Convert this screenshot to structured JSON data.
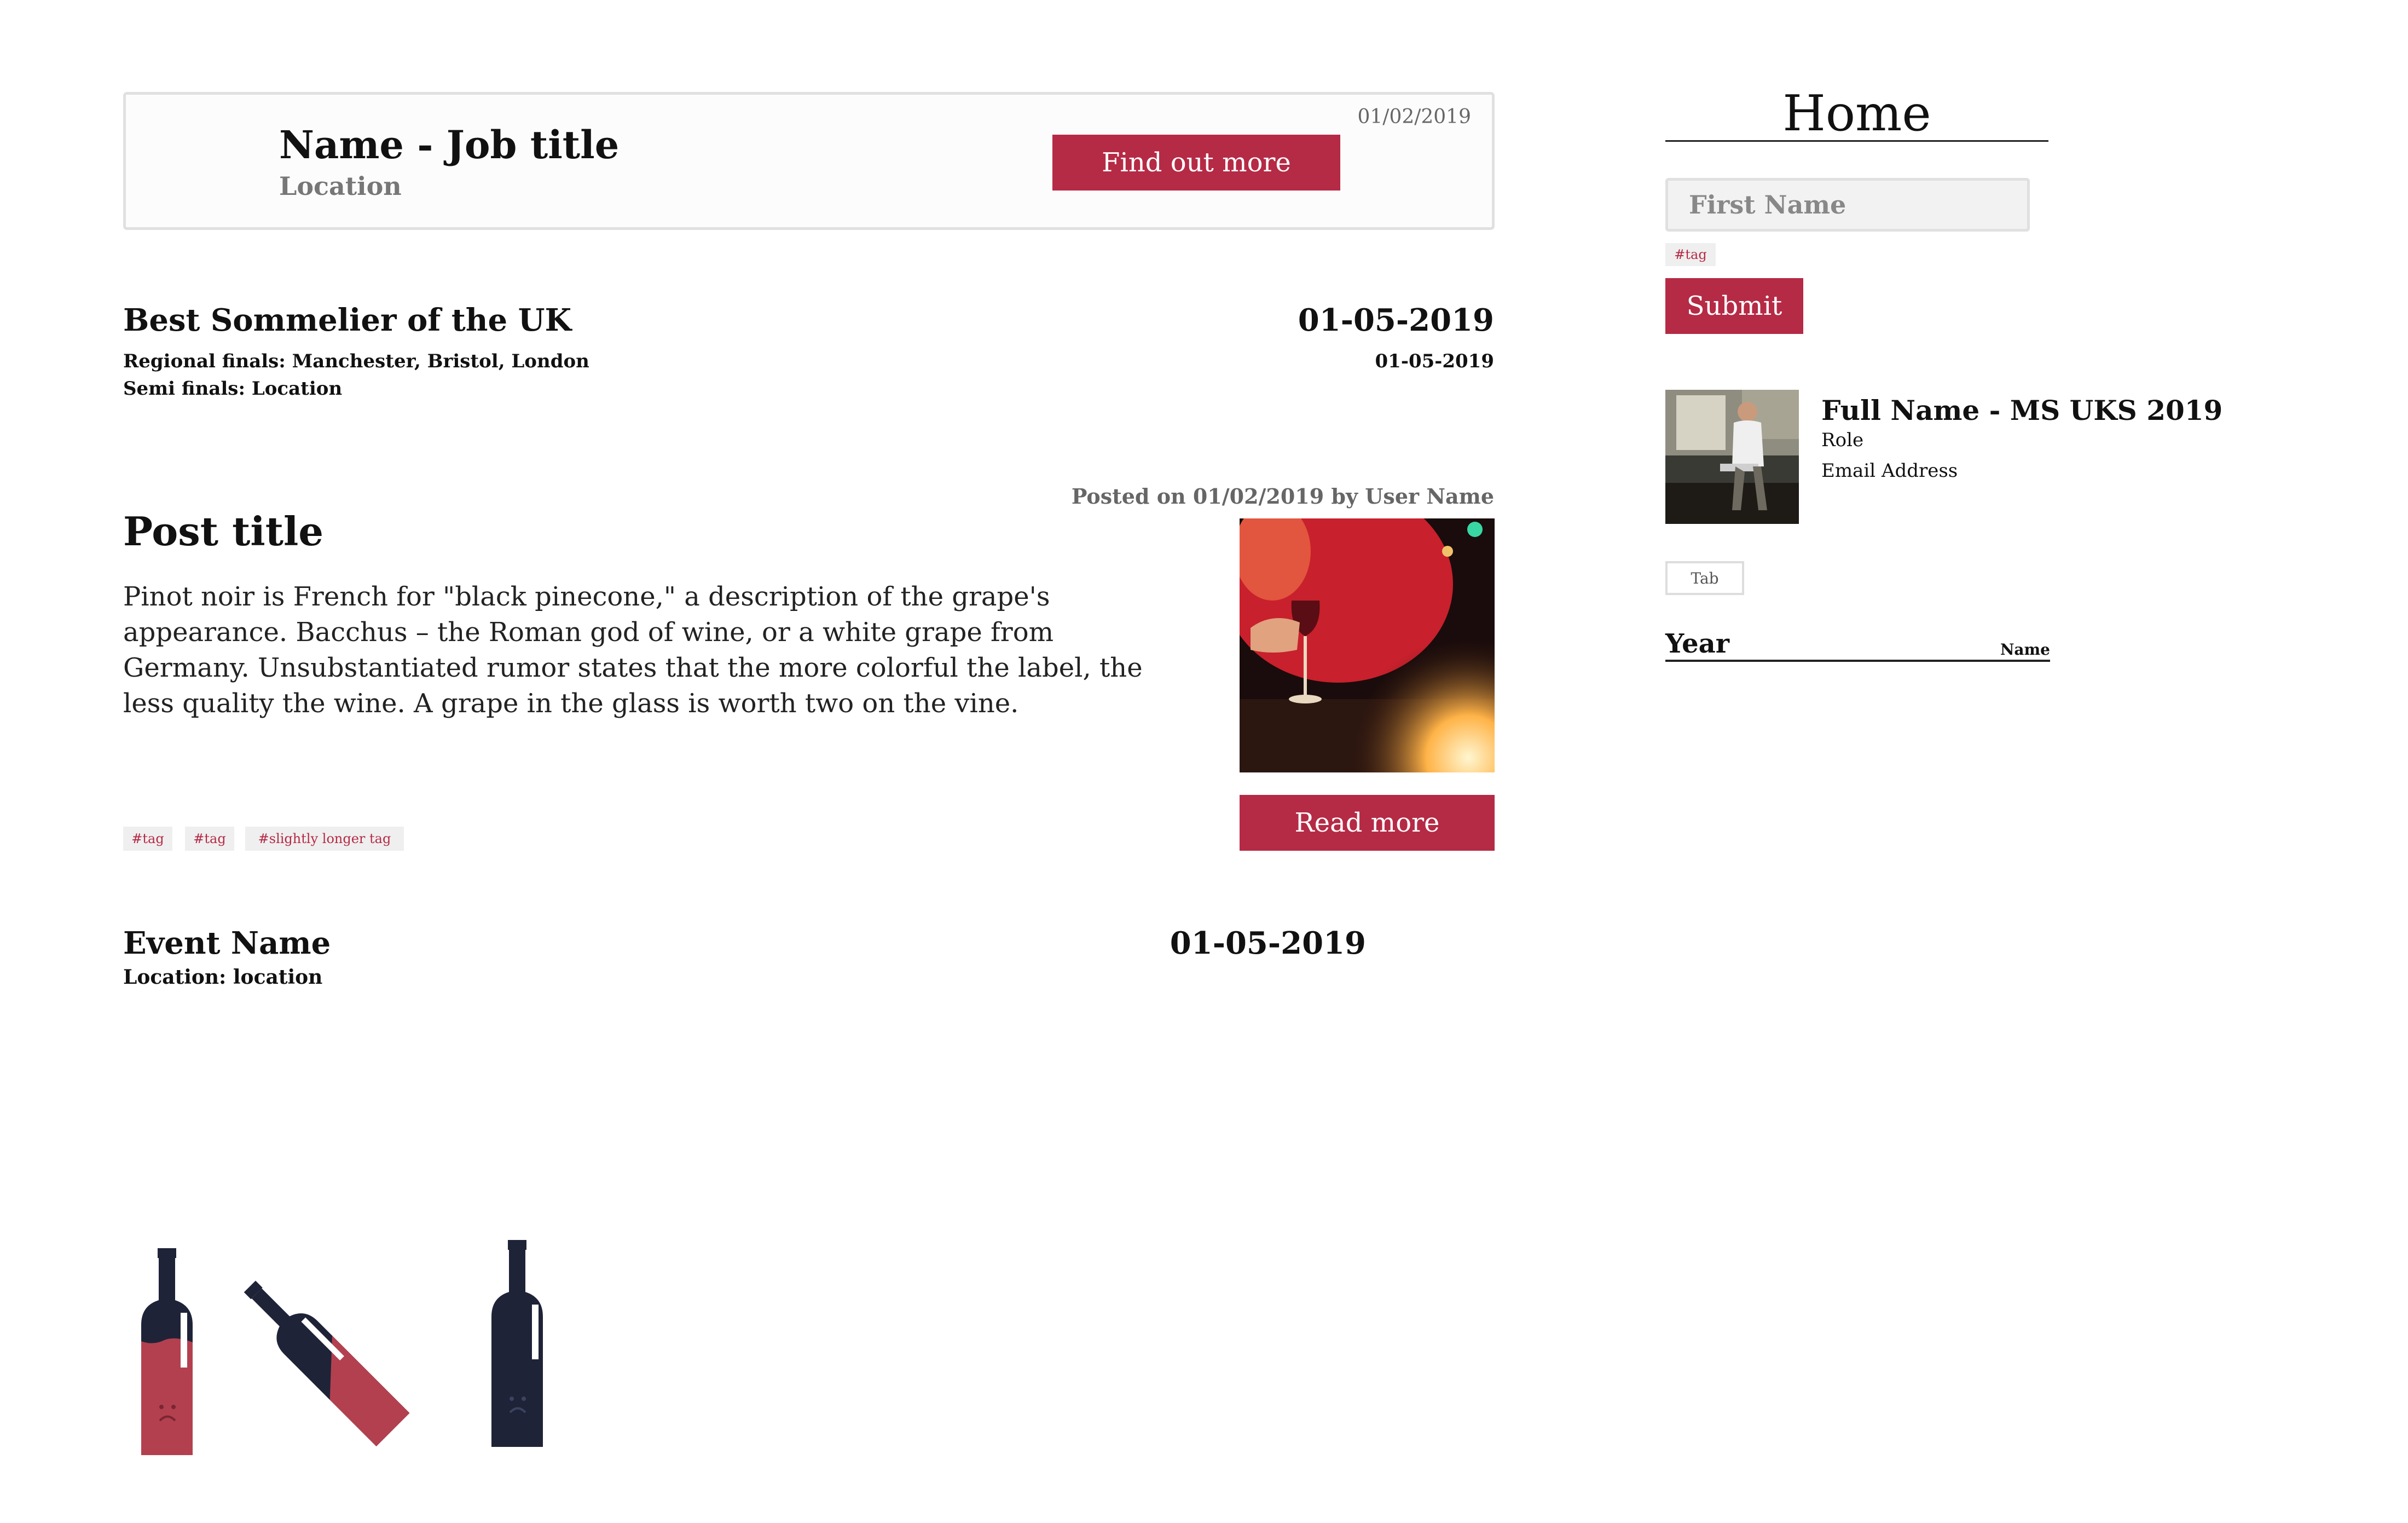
{
  "job_card": {
    "date": "01/02/2019",
    "title": "Name - Job title",
    "location": "Location",
    "button_label": "Find out more"
  },
  "competition": {
    "title": "Best Sommelier of the UK",
    "date": "01-05-2019",
    "line1": "Regional finals: Manchester, Bristol, London",
    "line2": "Semi finals: Location",
    "date_small": "01-05-2019"
  },
  "post": {
    "meta": "Posted on 01/02/2019 by User Name",
    "title": "Post title",
    "body": "Pinot noir is French for \"black pinecone,\" a description of the grape's appearance. Bacchus – the Roman god of wine, or a white grape from Germany. Unsubstantiated rumor states that the more colorful the label, the less quality the wine. A grape in the glass is worth two on the vine.",
    "read_more_label": "Read more",
    "tags": [
      "#tag",
      "#tag",
      "#slightly longer tag"
    ]
  },
  "event": {
    "name": "Event Name",
    "location": "Location: location",
    "date": "01-05-2019"
  },
  "sidebar": {
    "home_title": "Home",
    "first_name_placeholder": "First Name",
    "tag": "#tag",
    "submit_label": "Submit",
    "profile": {
      "name": "Full Name - MS UKS 2019",
      "role": "Role",
      "email": "Email Address"
    },
    "tab_label": "Tab",
    "year_label": "Year",
    "name_label": "Name"
  },
  "colors": {
    "accent": "#b52a45",
    "bottle_dark": "#1f2338",
    "bottle_wine": "#b3404f"
  }
}
